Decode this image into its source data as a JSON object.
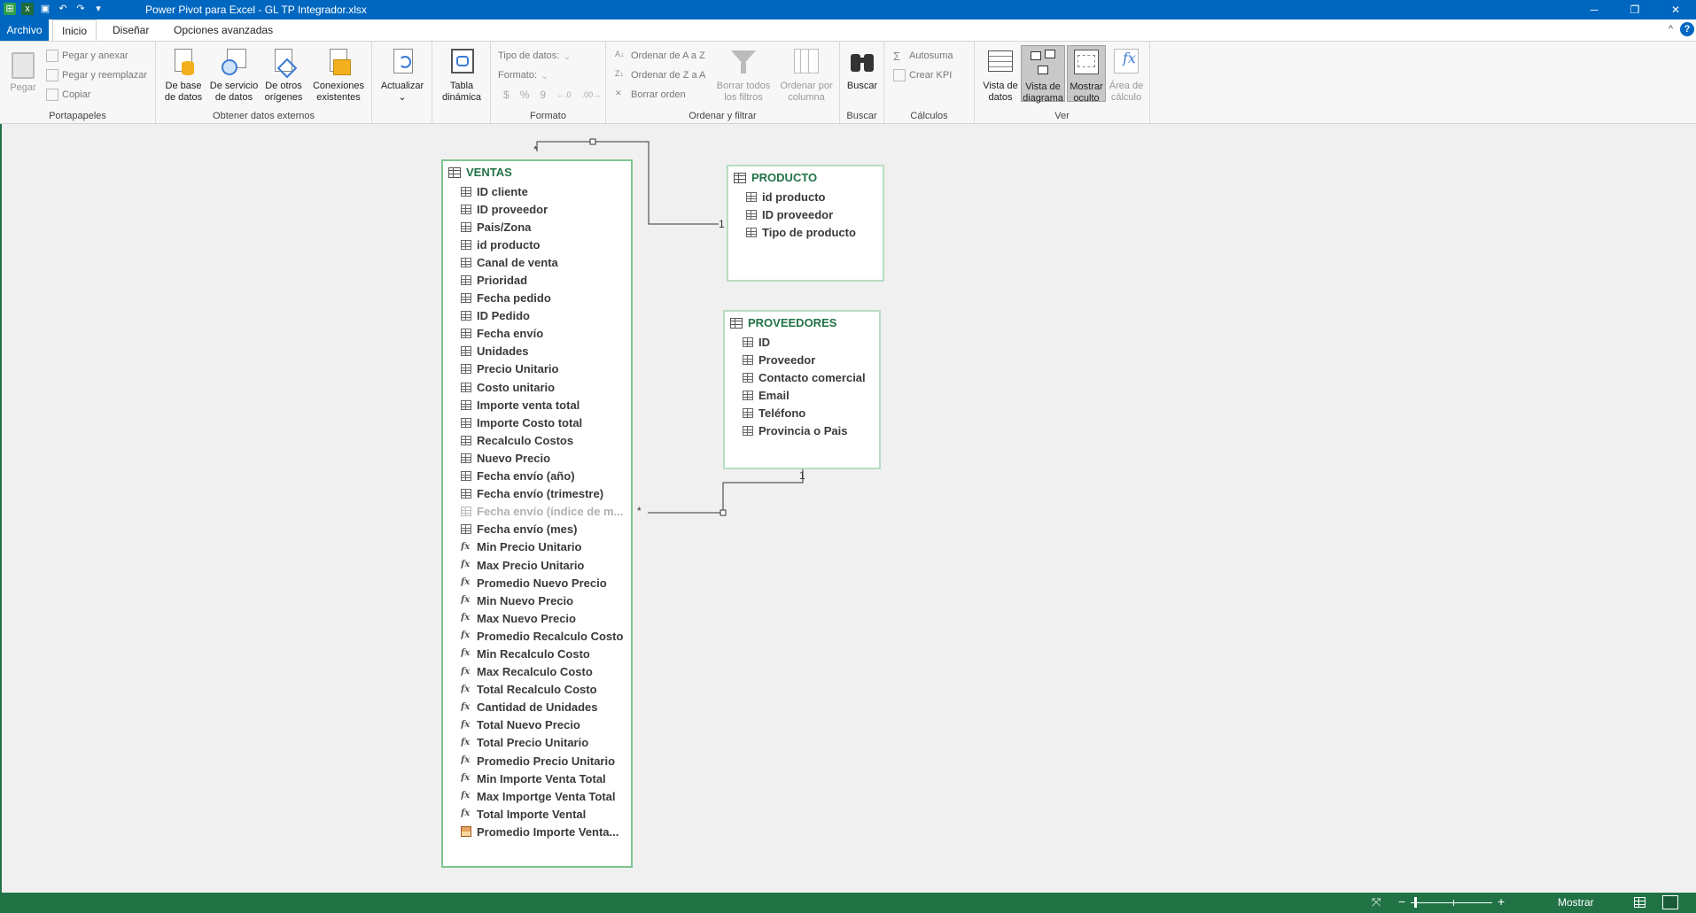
{
  "window": {
    "title": "Power Pivot para Excel - GL TP Integrador.xlsx",
    "min": "─",
    "max": "❐",
    "close": "✕",
    "help": "?",
    "collapse": "^"
  },
  "tabs": [
    "Archivo",
    "Inicio",
    "Diseñar",
    "Opciones avanzadas"
  ],
  "ribbon": {
    "portapapeles": {
      "label": "Portapapeles",
      "pegar": "Pegar",
      "pegar_anexar": "Pegar y anexar",
      "pegar_reemplazar": "Pegar y reemplazar",
      "copiar": "Copiar"
    },
    "externos": {
      "label": "Obtener datos externos",
      "base": [
        "De base",
        "de datos"
      ],
      "servicio": [
        "De servicio",
        "de datos"
      ],
      "otros": [
        "De otros",
        "orígenes"
      ],
      "conexiones": [
        "Conexiones",
        "existentes"
      ]
    },
    "actualizar": "Actualizar",
    "tabla": [
      "Tabla",
      "dinámica"
    ],
    "formato": {
      "label": "Formato",
      "tipo": "Tipo de datos:",
      "formato": "Formato:",
      "symbols": [
        "$",
        "%",
        "9",
        "←.0",
        ".00→"
      ]
    },
    "ordenar": {
      "label": "Ordenar y filtrar",
      "az": "Ordenar de A a Z",
      "za": "Ordenar de Z a A",
      "borrar_orden": "Borrar orden",
      "borrar_filtros": [
        "Borrar todos",
        "los filtros"
      ],
      "ordenar_columna": [
        "Ordenar por",
        "columna"
      ]
    },
    "buscar": {
      "label": "Buscar",
      "btn": "Buscar"
    },
    "calculos": {
      "label": "Cálculos",
      "autosuma": "Autosuma",
      "kpi": "Crear KPI"
    },
    "ver": {
      "label": "Ver",
      "datos": [
        "Vista de",
        "datos"
      ],
      "diagrama": [
        "Vista de",
        "diagrama"
      ],
      "oculto": [
        "Mostrar",
        "oculto"
      ],
      "calculo": [
        "Área de",
        "cálculo"
      ]
    }
  },
  "tables": {
    "ventas": {
      "name": "VENTAS",
      "columns": [
        {
          "t": "col",
          "n": "ID cliente"
        },
        {
          "t": "col",
          "n": "ID proveedor"
        },
        {
          "t": "col",
          "n": "Pais/Zona"
        },
        {
          "t": "col",
          "n": "id producto"
        },
        {
          "t": "col",
          "n": "Canal de venta"
        },
        {
          "t": "col",
          "n": "Prioridad"
        },
        {
          "t": "col",
          "n": "Fecha pedido"
        },
        {
          "t": "col",
          "n": "ID Pedido"
        },
        {
          "t": "col",
          "n": "Fecha envío"
        },
        {
          "t": "col",
          "n": "Unidades"
        },
        {
          "t": "col",
          "n": "Precio Unitario"
        },
        {
          "t": "col",
          "n": "Costo unitario"
        },
        {
          "t": "col",
          "n": "Importe venta total"
        },
        {
          "t": "col",
          "n": "Importe Costo total"
        },
        {
          "t": "col",
          "n": "Recalculo Costos"
        },
        {
          "t": "col",
          "n": "Nuevo Precio"
        },
        {
          "t": "col",
          "n": "Fecha envío (año)"
        },
        {
          "t": "col",
          "n": "Fecha envío (trimestre)"
        },
        {
          "t": "hid",
          "n": "Fecha envío (índice de m..."
        },
        {
          "t": "col",
          "n": "Fecha envío (mes)"
        },
        {
          "t": "fx",
          "n": "Min Precio Unitario"
        },
        {
          "t": "fx",
          "n": "Max Precio Unitario"
        },
        {
          "t": "fx",
          "n": "Promedio Nuevo Precio"
        },
        {
          "t": "fx",
          "n": "Min Nuevo Precio"
        },
        {
          "t": "fx",
          "n": "Max Nuevo Precio"
        },
        {
          "t": "fx",
          "n": "Promedio Recalculo Costo"
        },
        {
          "t": "fx",
          "n": "Min Recalculo Costo"
        },
        {
          "t": "fx",
          "n": "Max Recalculo Costo"
        },
        {
          "t": "fx",
          "n": "Total Recalculo Costo"
        },
        {
          "t": "fx",
          "n": "Cantidad de Unidades"
        },
        {
          "t": "fx",
          "n": "Total Nuevo Precio"
        },
        {
          "t": "fx",
          "n": "Total Precio Unitario"
        },
        {
          "t": "fx",
          "n": "Promedio Precio Unitario"
        },
        {
          "t": "fx",
          "n": "Min Importe Venta Total"
        },
        {
          "t": "fx",
          "n": "Max Importge Venta Total"
        },
        {
          "t": "fx",
          "n": "Total Importe Vental"
        },
        {
          "t": "kpi",
          "n": "Promedio Importe Venta..."
        }
      ]
    },
    "producto": {
      "name": "PRODUCTO",
      "columns": [
        {
          "t": "col",
          "n": "id producto"
        },
        {
          "t": "col",
          "n": "ID proveedor"
        },
        {
          "t": "col",
          "n": "Tipo de producto"
        }
      ]
    },
    "proveedores": {
      "name": "PROVEEDORES",
      "columns": [
        {
          "t": "col",
          "n": "ID"
        },
        {
          "t": "col",
          "n": "Proveedor"
        },
        {
          "t": "col",
          "n": "Contacto comercial"
        },
        {
          "t": "col",
          "n": "Email"
        },
        {
          "t": "col",
          "n": "Teléfono"
        },
        {
          "t": "col",
          "n": "Provincia o Pais"
        }
      ]
    }
  },
  "relationships": {
    "many": "*",
    "one": "1"
  },
  "status": {
    "mostrar": "Mostrar",
    "zoom_minus": "−",
    "zoom_plus": "+"
  },
  "colors": {
    "accent": "#217346",
    "title": "#0067c0"
  }
}
